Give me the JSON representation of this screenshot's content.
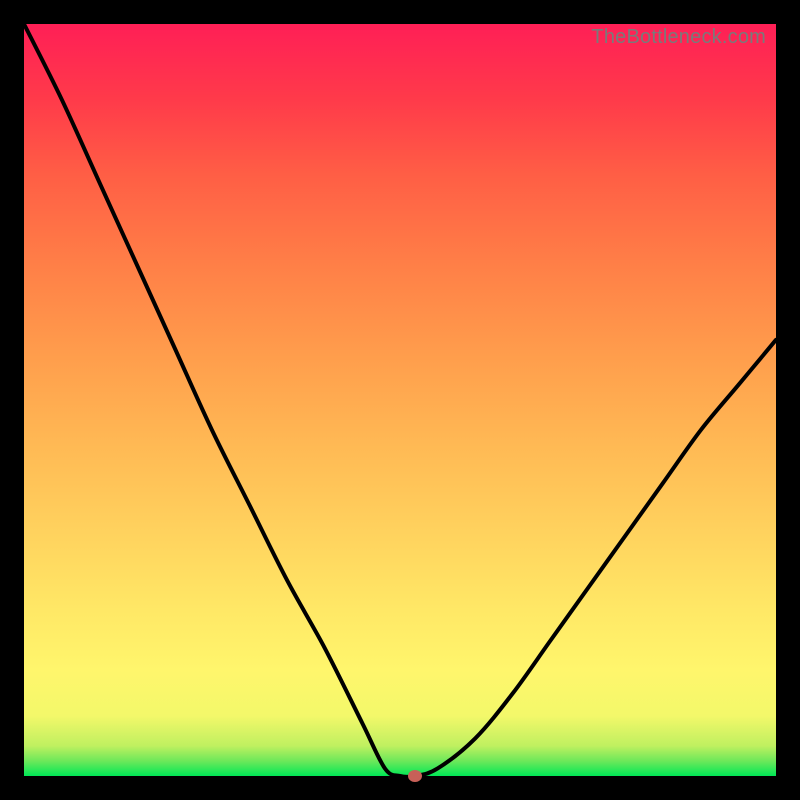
{
  "watermark": "TheBottleneck.com",
  "colors": {
    "curve_stroke": "#000000",
    "marker_fill": "#c76058"
  },
  "chart_data": {
    "type": "line",
    "title": "",
    "xlabel": "",
    "ylabel": "",
    "xlim": [
      0,
      100
    ],
    "ylim": [
      0,
      100
    ],
    "series": [
      {
        "name": "bottleneck-curve",
        "x": [
          0,
          5,
          10,
          15,
          20,
          25,
          30,
          35,
          40,
          45,
          48,
          50,
          52,
          55,
          60,
          65,
          70,
          75,
          80,
          85,
          90,
          95,
          100
        ],
        "y": [
          100,
          90,
          79,
          68,
          57,
          46,
          36,
          26,
          17,
          7,
          1,
          0,
          0,
          1,
          5,
          11,
          18,
          25,
          32,
          39,
          46,
          52,
          58
        ]
      }
    ],
    "marker": {
      "x": 52,
      "y": 0
    }
  }
}
